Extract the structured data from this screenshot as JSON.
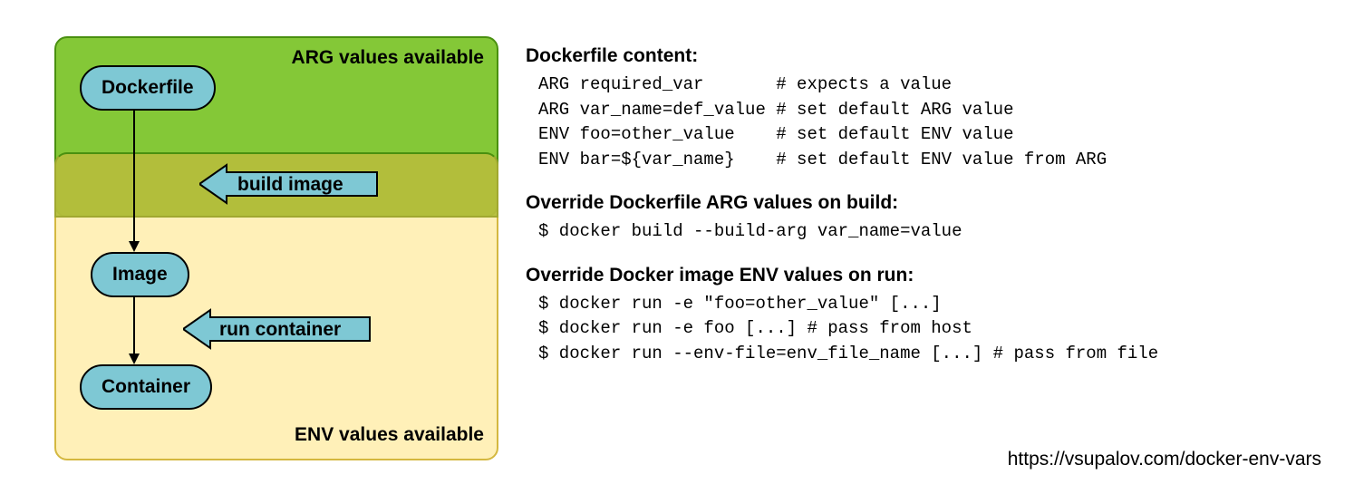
{
  "diagram": {
    "arg_box_label": "ARG values available",
    "env_box_label": "ENV values available",
    "nodes": {
      "dockerfile": "Dockerfile",
      "image": "Image",
      "container": "Container"
    },
    "arrows": {
      "build": "build image",
      "run": "run container"
    }
  },
  "sections": {
    "dockerfile_heading": "Dockerfile content:",
    "dockerfile_lines": [
      "ARG required_var       # expects a value",
      "ARG var_name=def_value # set default ARG value",
      "ENV foo=other_value    # set default ENV value",
      "ENV bar=${var_name}    # set default ENV value from ARG"
    ],
    "build_heading": "Override Dockerfile ARG values on build:",
    "build_lines": [
      "$ docker build --build-arg var_name=value"
    ],
    "run_heading": "Override Docker image ENV values on run:",
    "run_lines": [
      "$ docker run -e \"foo=other_value\" [...]",
      "$ docker run -e foo [...] # pass from host",
      "$ docker run --env-file=env_file_name [...] # pass from file"
    ]
  },
  "source_url": "https://vsupalov.com/docker-env-vars"
}
